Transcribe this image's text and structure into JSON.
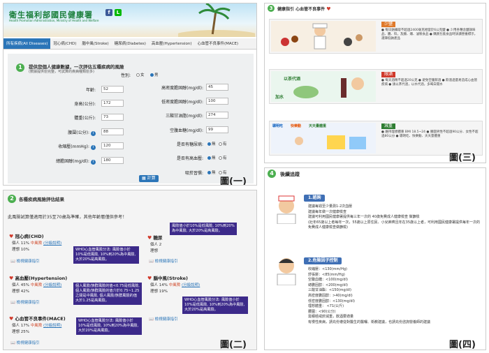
{
  "p1": {
    "logo": "衛生福利部國民健康署",
    "logo_sub": "Health Promotion Administration, Ministry of Health and Welfare",
    "tabs": [
      "所有疾病(All Diseases)",
      "冠心病(CHD)",
      "腦中風(Stroke)",
      "糖尿病(Diabetes)",
      "高血壓(Hypertension)",
      "心血管不良事件(MACE)"
    ],
    "section_title": "提供您個人健康數據，一次評估五種疾病的風險",
    "section_sub": "(數據提供愈完整，可試算的疾病種類愈多)",
    "gender_label": "性別:",
    "gender_female": "女",
    "gender_male": "男",
    "left_labels": [
      "年齡:",
      "身高(公分):",
      "體重(公斤):",
      "腰圍(公分):",
      "收縮壓(mmHg):",
      "總膽固醇(mg/dl):"
    ],
    "left_values": [
      "52",
      "172",
      "73",
      "88",
      "120",
      "180"
    ],
    "right_labels": [
      "高密度膽固醇(mg/dl):",
      "低密度膽固醇(mg/dl):",
      "三酸甘油脂(mg/dl):",
      "空腹血糖(mg/dl):",
      "是否有糖尿病:",
      "是否有高血壓:",
      "吸菸習慣:"
    ],
    "right_values": [
      "45",
      "100",
      "274",
      "99"
    ],
    "no": "無",
    "yes": "有",
    "calc": "計算",
    "caption": "圖(一)"
  },
  "p2": {
    "section_title": "各種疾病風險評估結果",
    "note": "此風險試算僅適用於35至70歲為準確，其他年齡層僅供參考！",
    "chd": {
      "title": "冠心病(CHD)",
      "l1a": "個人 11%",
      "l1b": "中風險",
      "l1c": "(分級說明)",
      "l2": "理想 10%"
    },
    "htn": {
      "title": "高血壓(Hypertension)",
      "l1a": "個人 45%",
      "l1b": "中風險",
      "l1c": "(分級說明)",
      "l2": "理想 42%"
    },
    "mace": {
      "title": "心血管不良事件(MACE)",
      "l1a": "個人 17%",
      "l1b": "中風險",
      "l1c": "(分級說明)",
      "l2": "理想 25%"
    },
    "dm": {
      "title": "糖尿",
      "l1a": "個人 2",
      "l2": "理想"
    },
    "stroke": {
      "title": "腦中風(Stroke)",
      "l1a": "個人 14%",
      "l1b": "中風險",
      "l1c": "(分級說明)",
      "l2": "理想 19%"
    },
    "guide": "檢視健康指引",
    "tip_top": "風險值小於10%是低風險, 10%到20%為中風險, 大於20%是高風險。",
    "tip_chd": "WHO心血管風險分法: 風險值小於10%是低風險, 10%到20%為中風險, 大於20%是高風險。",
    "tip_htn": "個人風險/族群風險的值<0.75是低風險, 個人風險/族群風險的值介於0.75~1.25之間是中風險, 個人風險/族群風險的值大於1.25是高風險。",
    "tip_stroke": "WHO心血管風險分法: 風險值小於10%是低風險, 10%到20%為中風險, 大於20%是高風險。",
    "tip_mace": "WHO心血管風險分法: 風險值小於10%是低風險, 10%到20%為中風險, 大於20%是高風險。",
    "caption": "圖(二)"
  },
  "p3": {
    "title": "健康指引 心血管不良事件",
    "card1_tag": "少鹽",
    "card1_txt": "● 每日鈉攝取不超過2400毫克相當於6公克鹽 ● 少用各種含鹽調味品、醬、料，及醃、燻、滷製食品 ● 購買包裝食品時詳讀營養標示，選擇低鈉產品",
    "card2_tag": "限酒",
    "card2_txt": "● 每天酒精不超過20公克 ● 避免空腹飲酒 ● 飲酒過量易造成心血管疾病 ● 請以茶代酒，以水代酒，多喝白開水",
    "card3_tag": "減重",
    "card3_txt": "● 維持理想體重 BMI 18.5~24 ● 腰圍男性不超過90公分、女性不超過80公分 ● 聰明吃、快樂動、天天量體重",
    "card2_label1": "以茶代酒",
    "card2_label2": "加水",
    "card3_label1": "聰明吃",
    "card3_label2": "快樂動",
    "card3_label3": "天天量體重",
    "caption": "圖(三)"
  },
  "p4": {
    "title": "後續追蹤",
    "h1": "1.諮詢",
    "h1_lines": [
      "建議每週至少量測1-2次血壓",
      "建議每年做一次健康檢查",
      "建議可利用國民健康署提供每三年一次的 40歲免費成人健康檢查 做篩檢",
      "(壯年65歲以上者每年一次，55歲以上原住民、小兒麻痺且年在35歲以上者，可利用國民健康署提供每年一次的免費成人健康檢查做篩檢)"
    ],
    "h2": "2.危險因子控制",
    "h2_lines": [
      "收縮壓：<130(mm/Hg)",
      "舒張壓：<85(mm/Hg)",
      "空腹血糖：<100(mg/dl)",
      "總膽固醇：<200(mg/dl)",
      "三酸甘油酯：<150(mg/dl)",
      "高密度膽固醇：>40(mg/dl)",
      "低密度膽固醇：<130(mg/dl)",
      "理想體重： <71(公斤)",
      "腰圍：<90(公分)",
      "需積極戒菸減重，飲酒要適量",
      "有慢性疾病，請充份遵從對醫生的醫囑、衛教建議，也請充份諮詢營養師的建議"
    ],
    "caption": "圖(四)"
  }
}
